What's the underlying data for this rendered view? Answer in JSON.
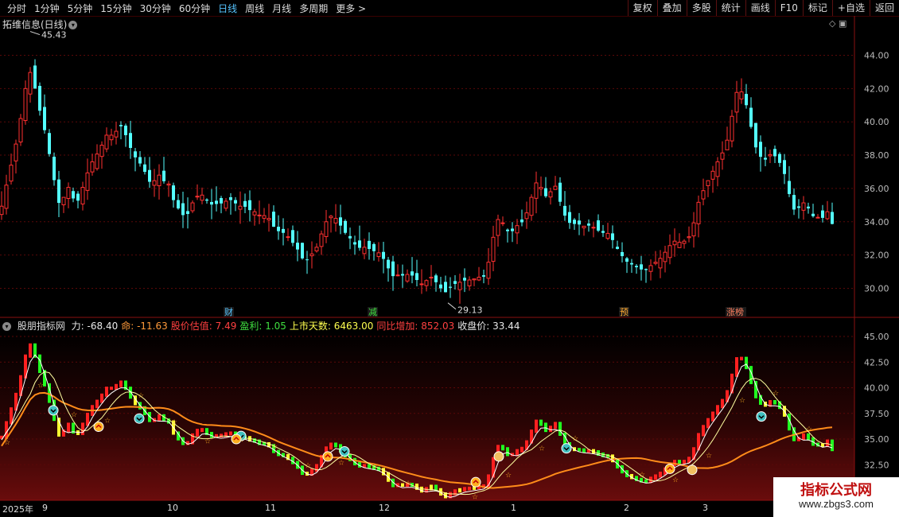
{
  "toolbar": {
    "left": [
      "分时",
      "1分钟",
      "5分钟",
      "15分钟",
      "30分钟",
      "60分钟",
      "日线",
      "周线",
      "月线",
      "多周期",
      "更多 >"
    ],
    "active": "日线",
    "right": [
      "复权",
      "叠加",
      "多股",
      "统计",
      "画线",
      "F10",
      "标记",
      "+自选",
      "返回"
    ]
  },
  "title": "拓维信息(日线)",
  "price_axis": [
    "44.00",
    "42.00",
    "40.00",
    "38.00",
    "36.00",
    "34.00",
    "32.00",
    "30.00"
  ],
  "high_label": "45.43",
  "low_label": "29.13",
  "event_labels": [
    "财",
    "减",
    "预",
    "涨榜"
  ],
  "indicator": {
    "name": "股朋指标网",
    "items": [
      {
        "label": "力: ",
        "value": "-68.40",
        "color": "#e8e8e8"
      },
      {
        "label": "命: ",
        "value": "-11.63",
        "color": "#ff9a3a"
      },
      {
        "label": "股价估值: ",
        "value": "7.49",
        "color": "#ff4040"
      },
      {
        "label": "盈利: ",
        "value": "1.05",
        "color": "#40e040"
      },
      {
        "label": "上市天数: ",
        "value": "6463.00",
        "color": "#ffff50"
      },
      {
        "label": "同比增加: ",
        "value": "852.03",
        "color": "#ff4040"
      },
      {
        "label": "收盘价: ",
        "value": "33.44",
        "color": "#e8e8e8"
      }
    ],
    "axis": [
      "45.00",
      "42.50",
      "40.00",
      "37.50",
      "35.00",
      "32.50"
    ]
  },
  "date_axis": [
    "2025年",
    "9",
    "10",
    "11",
    "12",
    "1",
    "2",
    "3"
  ],
  "watermark": {
    "line1": "指标公式网",
    "line2": "www.zbgs3.com"
  },
  "colors": {
    "up": "#ff3030",
    "down": "#54ffff",
    "ma_orange": "#ff8c1a"
  }
}
